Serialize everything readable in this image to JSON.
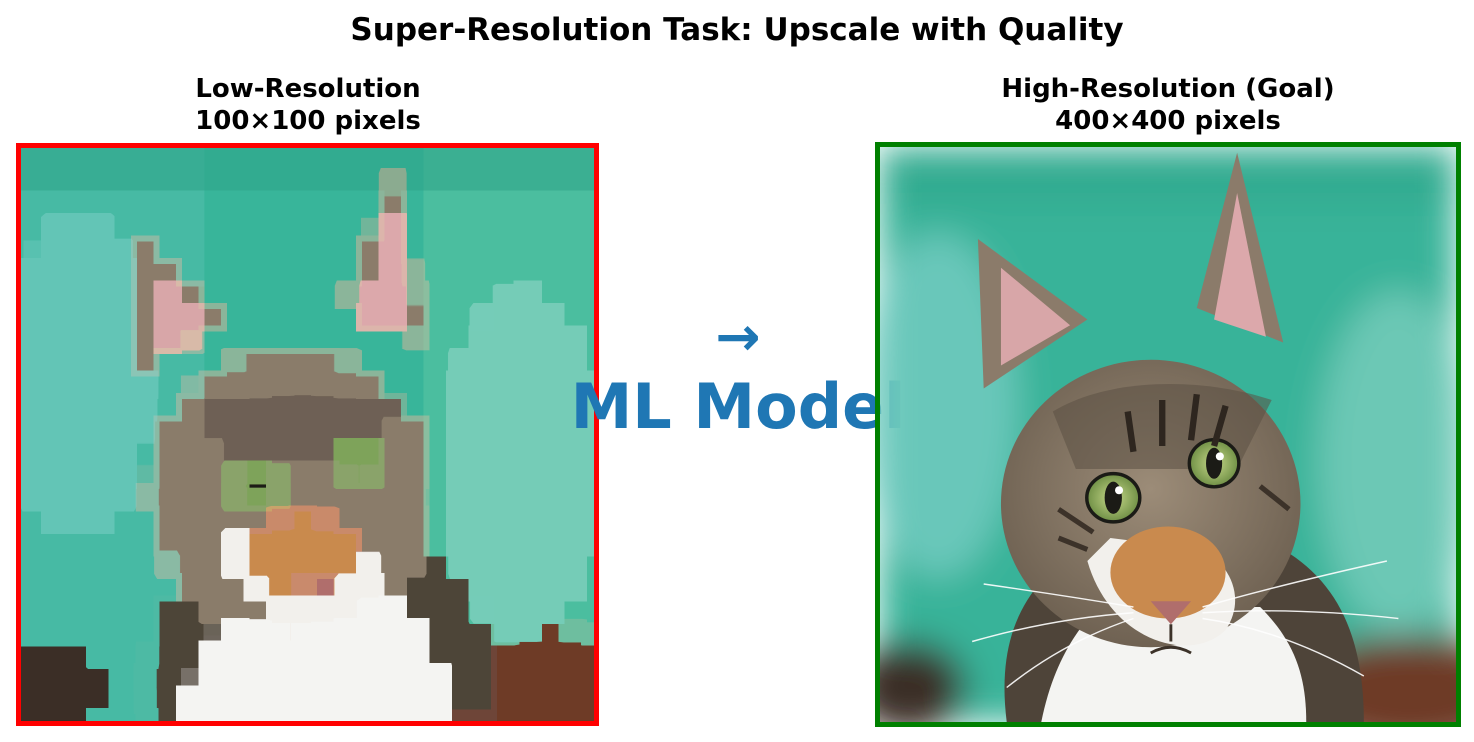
{
  "title": "Super-Resolution Task: Upscale with Quality",
  "low_res": {
    "title_line1": "Low-Resolution",
    "title_line2": "100×100 pixels",
    "border_color": "#ff0000",
    "image_subject": "tabby-cat-photo-pixelated"
  },
  "high_res": {
    "title_line1": "High-Resolution (Goal)",
    "title_line2": "400×400 pixels",
    "border_color": "#008000",
    "image_subject": "tabby-cat-photo-sharp"
  },
  "process": {
    "arrow": "→",
    "label": "ML Model",
    "color": "#1f77b4"
  }
}
